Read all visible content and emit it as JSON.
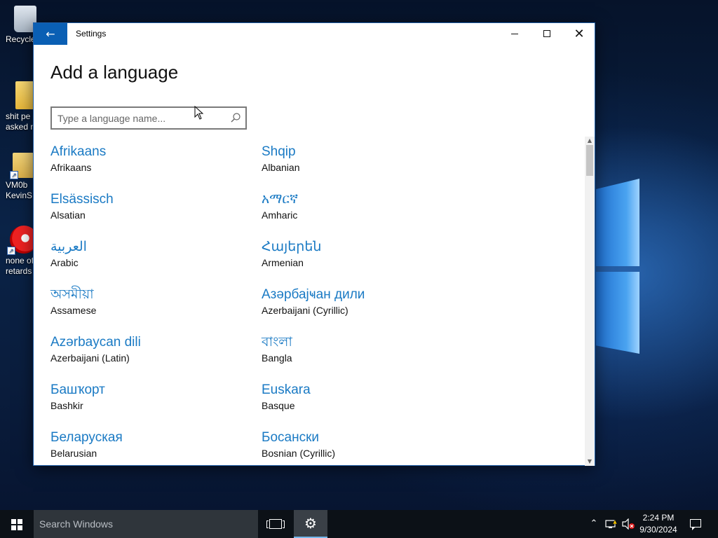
{
  "desktop": {
    "icons": [
      {
        "label": "Recycle",
        "icon": "recycle-bin-icon"
      },
      {
        "label": "shit pe",
        "label2": "asked n",
        "icon": "folder-icon"
      },
      {
        "label": "VM0b",
        "label2": "KevinS",
        "icon": "shortcut-folder-icon"
      },
      {
        "label": "none of",
        "label2": "retards l",
        "icon": "app-shortcut-icon"
      }
    ]
  },
  "window": {
    "title": "Settings",
    "back_icon": "back-arrow-icon",
    "page_title": "Add a language",
    "search": {
      "placeholder": "Type a language name...",
      "value": ""
    }
  },
  "languages": [
    {
      "native": "Afrikaans",
      "english": "Afrikaans"
    },
    {
      "native": "Shqip",
      "english": "Albanian"
    },
    {
      "native": "Elsässisch",
      "english": "Alsatian"
    },
    {
      "native": "አማርኛ",
      "english": "Amharic"
    },
    {
      "native": "العربية",
      "english": "Arabic"
    },
    {
      "native": "Հայերեն",
      "english": "Armenian"
    },
    {
      "native": "অসমীয়া",
      "english": "Assamese"
    },
    {
      "native": "Азәрбајҹан дили",
      "english": "Azerbaijani (Cyrillic)"
    },
    {
      "native": "Azərbaycan dili",
      "english": "Azerbaijani (Latin)"
    },
    {
      "native": "বাংলা",
      "english": "Bangla"
    },
    {
      "native": "Башҡорт",
      "english": "Bashkir"
    },
    {
      "native": "Euskara",
      "english": "Basque"
    },
    {
      "native": "Беларуская",
      "english": "Belarusian"
    },
    {
      "native": "Босански",
      "english": "Bosnian (Cyrillic)"
    }
  ],
  "taskbar": {
    "search_placeholder": "Search Windows",
    "time": "2:24 PM",
    "date": "9/30/2024"
  },
  "colors": {
    "accent": "#0a5fb4",
    "link": "#1a7ac4",
    "taskbar": "#0c1117"
  }
}
